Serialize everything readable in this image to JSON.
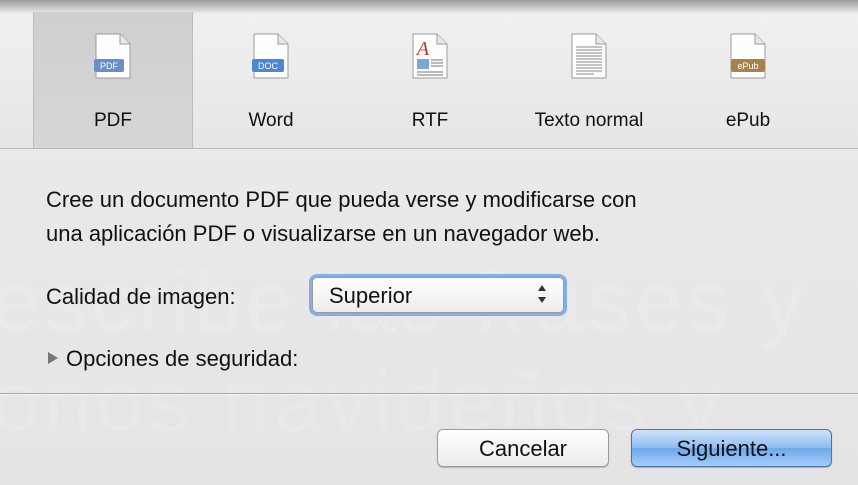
{
  "formats": [
    {
      "label": "PDF",
      "badge": "PDF",
      "badge_color": "#6a8fc8"
    },
    {
      "label": "Word",
      "badge": "DOC",
      "badge_color": "#4d86d6"
    },
    {
      "label": "RTF",
      "badge": "A",
      "badge_color": "#c0392b"
    },
    {
      "label": "Texto normal",
      "badge": "",
      "badge_color": "#9a9a9a"
    },
    {
      "label": "ePub",
      "badge": "ePub",
      "badge_color": "#a8804a"
    }
  ],
  "selected_format": "PDF",
  "description_line1": "Cree un documento PDF que pueda verse y modificarse con",
  "description_line2": "una aplicación PDF o visualizarse en un navegador web.",
  "quality": {
    "label": "Calidad de imagen:",
    "selected": "Superior"
  },
  "security": {
    "label": "Opciones de seguridad:",
    "expanded": false
  },
  "buttons": {
    "cancel": "Cancelar",
    "next": "Siguiente..."
  },
  "background_text": {
    "line1": "escribe las frases y",
    "line2": "onos navideños y"
  },
  "colors": {
    "focus_ring": "#84aee6",
    "primary_button": "#6ea7ec"
  }
}
